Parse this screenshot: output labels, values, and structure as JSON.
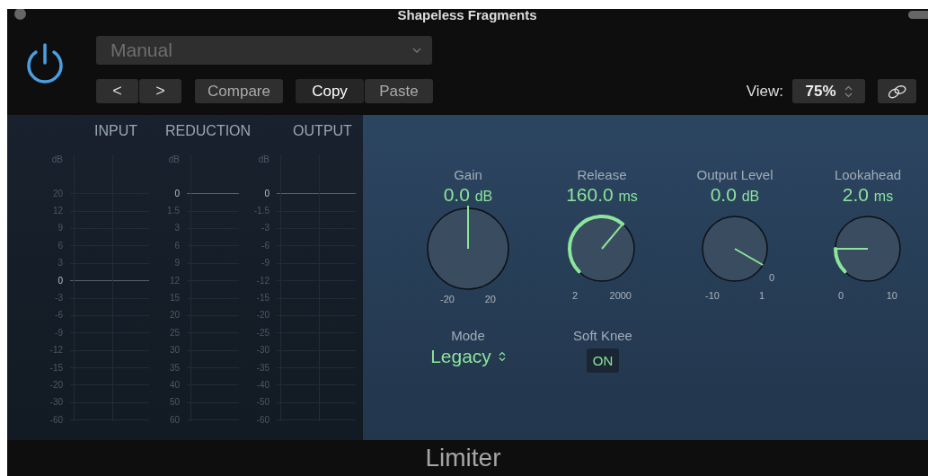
{
  "window": {
    "title": "Shapeless Fragments"
  },
  "header": {
    "power_on": true,
    "preset": "Manual",
    "compare": "Compare",
    "clipboard": [
      {
        "label": "Copy",
        "selected": true
      },
      {
        "label": "Paste",
        "selected": false
      }
    ],
    "nav": [
      "<",
      ">"
    ],
    "view_label": "View:",
    "view_value": "75%"
  },
  "meters": [
    {
      "title": "INPUT",
      "unit": "dB",
      "ticks": [
        {
          "label": "20",
          "emphasized": false
        },
        {
          "label": "12",
          "emphasized": false
        },
        {
          "label": "9",
          "emphasized": false
        },
        {
          "label": "6",
          "emphasized": false
        },
        {
          "label": "3",
          "emphasized": false
        },
        {
          "label": "0",
          "emphasized": true
        },
        {
          "label": "-3",
          "emphasized": false
        },
        {
          "label": "-6",
          "emphasized": false
        },
        {
          "label": "-9",
          "emphasized": false
        },
        {
          "label": "-12",
          "emphasized": false
        },
        {
          "label": "-15",
          "emphasized": false
        },
        {
          "label": "-20",
          "emphasized": false
        },
        {
          "label": "-30",
          "emphasized": false
        },
        {
          "label": "-60",
          "emphasized": false
        }
      ]
    },
    {
      "title": "REDUCTION",
      "unit": "dB",
      "ticks": [
        {
          "label": "0",
          "emphasized": true
        },
        {
          "label": "1.5",
          "emphasized": false
        },
        {
          "label": "3",
          "emphasized": false
        },
        {
          "label": "6",
          "emphasized": false
        },
        {
          "label": "9",
          "emphasized": false
        },
        {
          "label": "12",
          "emphasized": false
        },
        {
          "label": "15",
          "emphasized": false
        },
        {
          "label": "20",
          "emphasized": false
        },
        {
          "label": "25",
          "emphasized": false
        },
        {
          "label": "30",
          "emphasized": false
        },
        {
          "label": "35",
          "emphasized": false
        },
        {
          "label": "40",
          "emphasized": false
        },
        {
          "label": "50",
          "emphasized": false
        },
        {
          "label": "60",
          "emphasized": false
        }
      ]
    },
    {
      "title": "OUTPUT",
      "unit": "dB",
      "ticks": [
        {
          "label": "0",
          "emphasized": true
        },
        {
          "label": "-1.5",
          "emphasized": false
        },
        {
          "label": "-3",
          "emphasized": false
        },
        {
          "label": "-6",
          "emphasized": false
        },
        {
          "label": "-9",
          "emphasized": false
        },
        {
          "label": "-12",
          "emphasized": false
        },
        {
          "label": "-15",
          "emphasized": false
        },
        {
          "label": "-20",
          "emphasized": false
        },
        {
          "label": "-25",
          "emphasized": false
        },
        {
          "label": "-30",
          "emphasized": false
        },
        {
          "label": "-35",
          "emphasized": false
        },
        {
          "label": "-40",
          "emphasized": false
        },
        {
          "label": "-50",
          "emphasized": false
        },
        {
          "label": "-60",
          "emphasized": false
        }
      ]
    }
  ],
  "knobs": [
    {
      "label": "Gain",
      "value": "0.0",
      "unit": "dB",
      "scale_min": "-20",
      "scale_max": "20"
    },
    {
      "label": "Release",
      "value": "160.0",
      "unit": "ms",
      "scale_min": "2",
      "scale_max": "2000"
    },
    {
      "label": "Output Level",
      "value": "0.0",
      "unit": "dB",
      "scale_min": "-10",
      "scale_max": "1",
      "end_mark": "0"
    },
    {
      "label": "Lookahead",
      "value": "2.0",
      "unit": "ms",
      "scale_min": "0",
      "scale_max": "10"
    }
  ],
  "mode": {
    "label": "Mode",
    "value": "Legacy"
  },
  "soft_knee": {
    "label": "Soft Knee",
    "button": "ON",
    "on": true
  },
  "footer": {
    "title": "Limiter"
  }
}
